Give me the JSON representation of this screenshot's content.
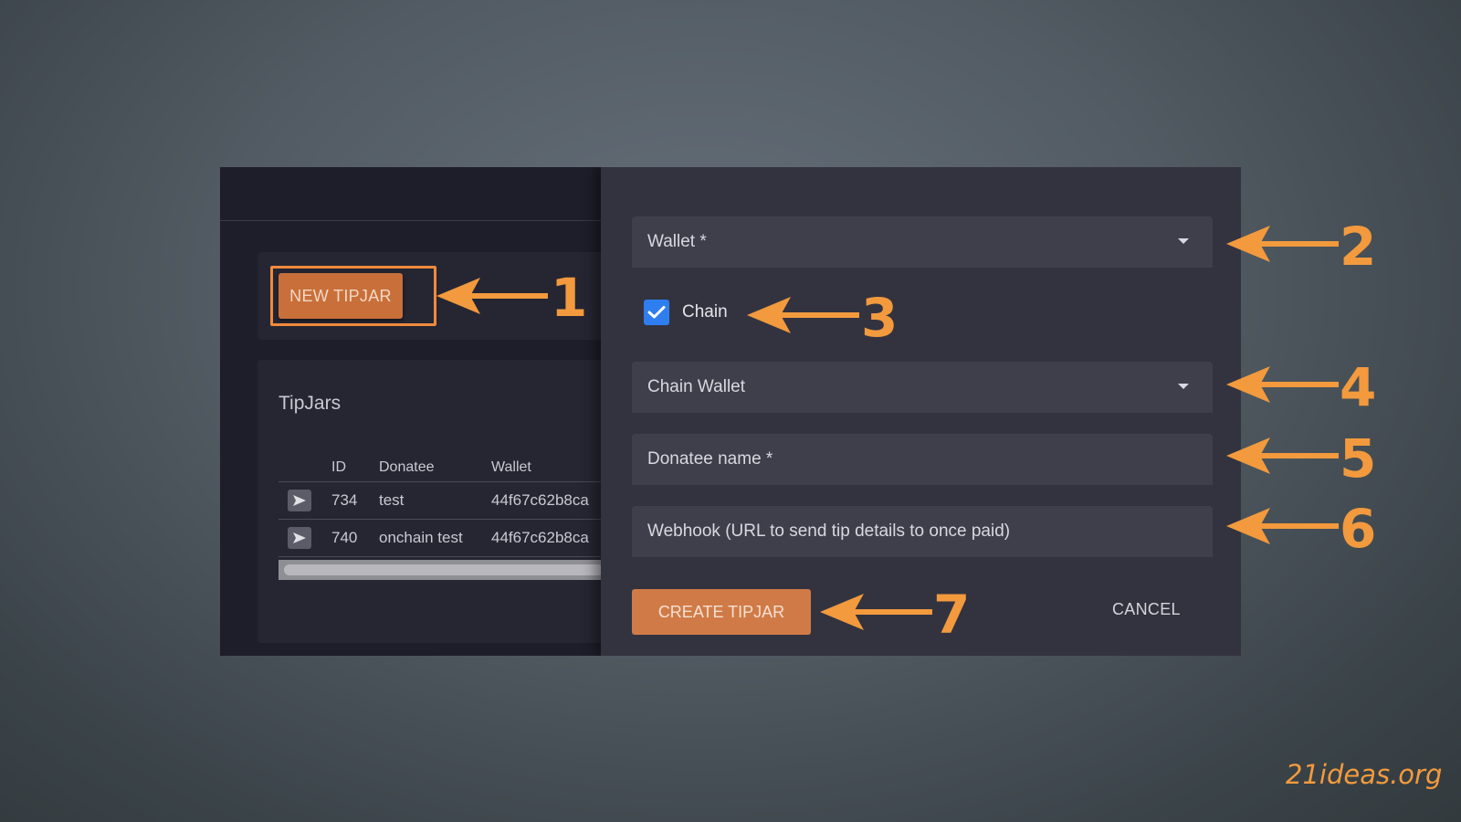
{
  "left_panel": {
    "new_button": "NEW TIPJAR",
    "tipjars_title": "TipJars",
    "table": {
      "columns": [
        "ID",
        "Donatee",
        "Wallet"
      ],
      "rows": [
        {
          "id": "734",
          "donatee": "test",
          "wallet": "44f67c62b8ca"
        },
        {
          "id": "740",
          "donatee": "onchain test",
          "wallet": "44f67c62b8ca"
        }
      ]
    }
  },
  "dialog": {
    "wallet_label": "Wallet *",
    "chain_checkbox_label": "Chain",
    "chain_checked": true,
    "chain_wallet_label": "Chain Wallet",
    "donatee_name_label": "Donatee name *",
    "webhook_label": "Webhook (URL to send tip details to once paid)",
    "create_button": "CREATE TIPJAR",
    "cancel_button": "CANCEL"
  },
  "annotations": {
    "numbers": [
      "1",
      "2",
      "3",
      "4",
      "5",
      "6",
      "7"
    ],
    "color": "#f29a3d"
  },
  "watermark": "21ideas.org",
  "colors": {
    "accent_orange": "#d07b47",
    "checkbox_blue": "#2f7ef0",
    "dialog_bg": "#33333f",
    "panel_bg": "#1e1e2b"
  }
}
